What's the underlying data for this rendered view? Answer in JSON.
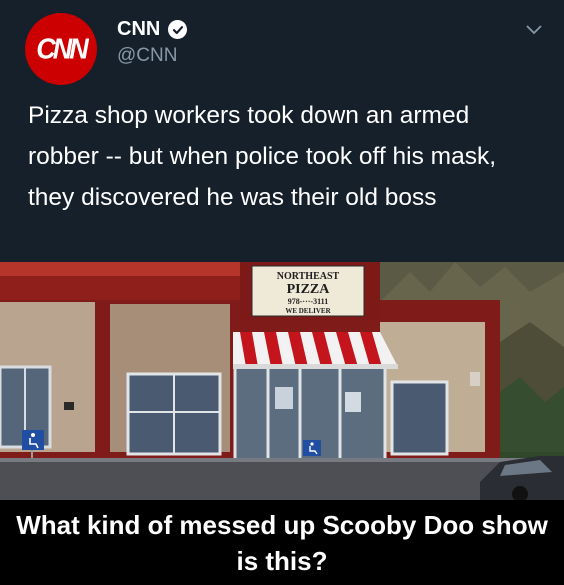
{
  "tweet": {
    "avatar_logo": "CNN",
    "display_name": "CNN",
    "handle": "@CNN",
    "verified": true,
    "text": "Pizza shop workers took down an armed robber -- but when police took off his mask, they discovered he was their old boss"
  },
  "photo": {
    "sign": {
      "line1": "NORTHEAST",
      "line2": "PIZZA",
      "line3": "978-···-3111",
      "line4": "WE DELIVER"
    }
  },
  "meme_caption": "What kind of messed up Scooby Doo show is this?",
  "colors": {
    "card_bg": "#15202b",
    "cnn_red": "#cc0000",
    "handle_gray": "#8899a6",
    "awning_red": "#c4151c",
    "building_red": "#8e1f1b"
  },
  "icons": {
    "verified": "verified-badge-icon",
    "menu": "chevron-down-icon",
    "accessible": "wheelchair-icon"
  }
}
